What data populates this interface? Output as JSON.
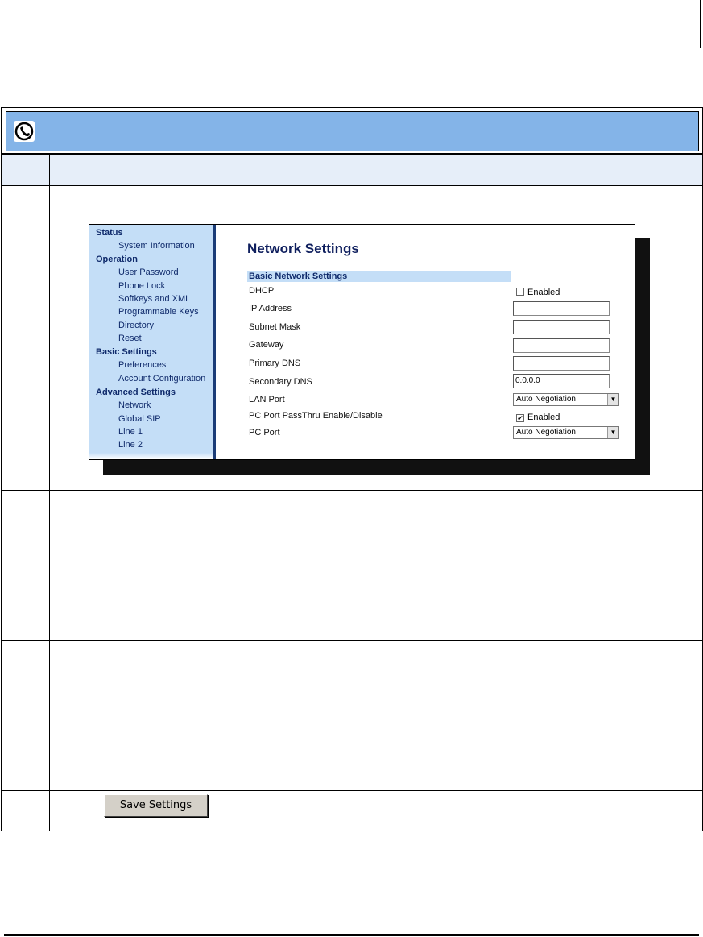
{
  "screenshot": {
    "nav": [
      {
        "type": "section",
        "label": "Status"
      },
      {
        "type": "item",
        "label": "System Information"
      },
      {
        "type": "section",
        "label": "Operation"
      },
      {
        "type": "item",
        "label": "User Password"
      },
      {
        "type": "item",
        "label": "Phone Lock"
      },
      {
        "type": "item",
        "label": "Softkeys and XML"
      },
      {
        "type": "item",
        "label": "Programmable Keys"
      },
      {
        "type": "item",
        "label": "Directory"
      },
      {
        "type": "item",
        "label": "Reset"
      },
      {
        "type": "section",
        "label": "Basic Settings"
      },
      {
        "type": "item",
        "label": "Preferences"
      },
      {
        "type": "item",
        "label": "Account Configuration"
      },
      {
        "type": "section",
        "label": "Advanced Settings"
      },
      {
        "type": "item",
        "label": "Network"
      },
      {
        "type": "item",
        "label": "Global SIP"
      },
      {
        "type": "item",
        "label": "Line 1"
      },
      {
        "type": "item",
        "label": "Line 2"
      }
    ],
    "page_title": "Network Settings",
    "section_header": "Basic Network Settings",
    "labels": {
      "dhcp": "DHCP",
      "ip_address": "IP Address",
      "subnet_mask": "Subnet Mask",
      "gateway": "Gateway",
      "primary_dns": "Primary DNS",
      "secondary_dns": "Secondary DNS",
      "lan_port": "LAN Port",
      "pc_passthru": "PC Port PassThru Enable/Disable",
      "pc_port": "PC Port"
    },
    "values": {
      "dhcp_enabled_label": "Enabled",
      "dhcp_checked": "",
      "ip_address": "",
      "subnet_mask": "",
      "gateway": "",
      "primary_dns": "",
      "secondary_dns": "0.0.0.0",
      "lan_port": "Auto Negotiation",
      "pc_passthru_label": "Enabled",
      "pc_passthru_checked": "✔",
      "pc_port": "Auto Negotiation",
      "dropdown_arrow": "▼"
    }
  },
  "save_button": "Save Settings"
}
